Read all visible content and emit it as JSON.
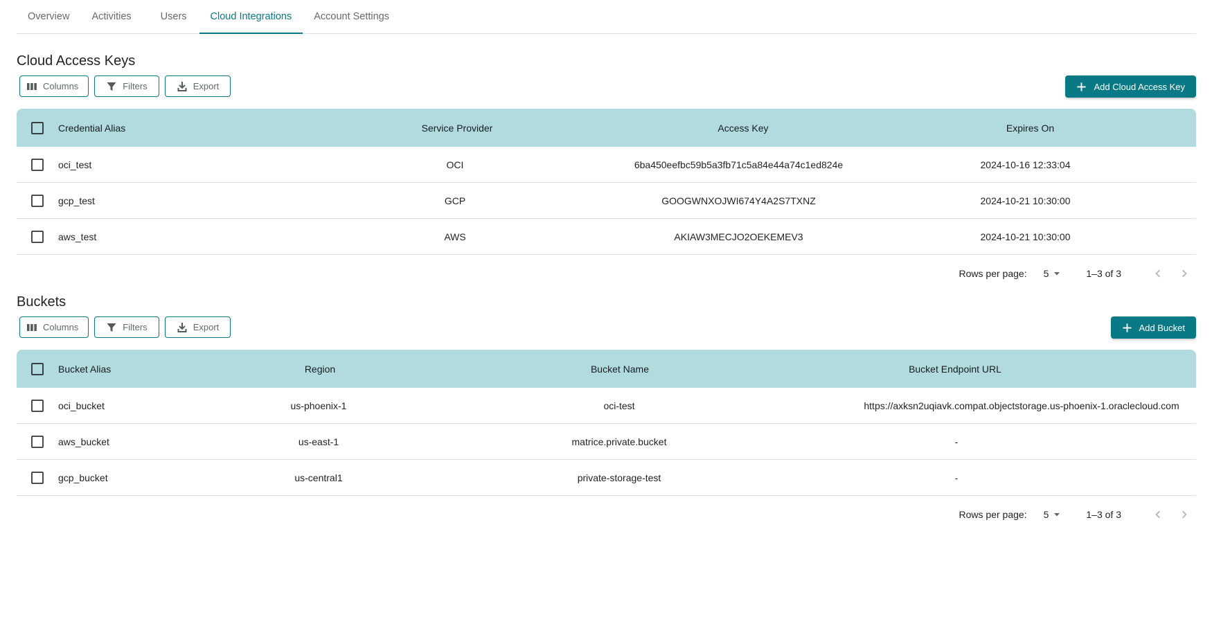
{
  "tabs": [
    {
      "label": "Overview"
    },
    {
      "label": "Activities"
    },
    {
      "label": "Users"
    },
    {
      "label": "Cloud Integrations"
    },
    {
      "label": "Account Settings"
    }
  ],
  "toolbar": {
    "columns_label": "Columns",
    "filters_label": "Filters",
    "export_label": "Export"
  },
  "keys": {
    "title": "Cloud Access Keys",
    "add_label": "Add Cloud Access Key",
    "headers": [
      "Credential Alias",
      "Service Provider",
      "Access Key",
      "Expires On"
    ],
    "rows": [
      [
        "oci_test",
        "OCI",
        "6ba450eefbc59b5a3fb71c5a84e44a74c1ed824e",
        "2024-10-16 12:33:04"
      ],
      [
        "gcp_test",
        "GCP",
        "GOOGWNXOJWI674Y4A2S7TXNZ",
        "2024-10-21 10:30:00"
      ],
      [
        "aws_test",
        "AWS",
        "AKIAW3MECJO2OEKEMEV3",
        "2024-10-21 10:30:00"
      ]
    ],
    "pager": {
      "rows_per_page_label": "Rows per page:",
      "rows_per_page": "5",
      "range": "1–3 of 3"
    }
  },
  "buckets": {
    "title": "Buckets",
    "add_label": "Add Bucket",
    "headers": [
      "Bucket Alias",
      "Region",
      "Bucket Name",
      "Bucket Endpoint URL"
    ],
    "rows": [
      [
        "oci_bucket",
        "us-phoenix-1",
        "oci-test",
        "https://axksn2uqiavk.compat.objectstorage.us-phoenix-1.oraclecloud.com"
      ],
      [
        "aws_bucket",
        "us-east-1",
        "matrice.private.bucket",
        "-"
      ],
      [
        "gcp_bucket",
        "us-central1",
        "private-storage-test",
        "-"
      ]
    ],
    "pager": {
      "rows_per_page_label": "Rows per page:",
      "rows_per_page": "5",
      "range": "1–3 of 3"
    }
  },
  "colors": {
    "accent": "#097a85",
    "header_bg": "#b1dbdf"
  }
}
